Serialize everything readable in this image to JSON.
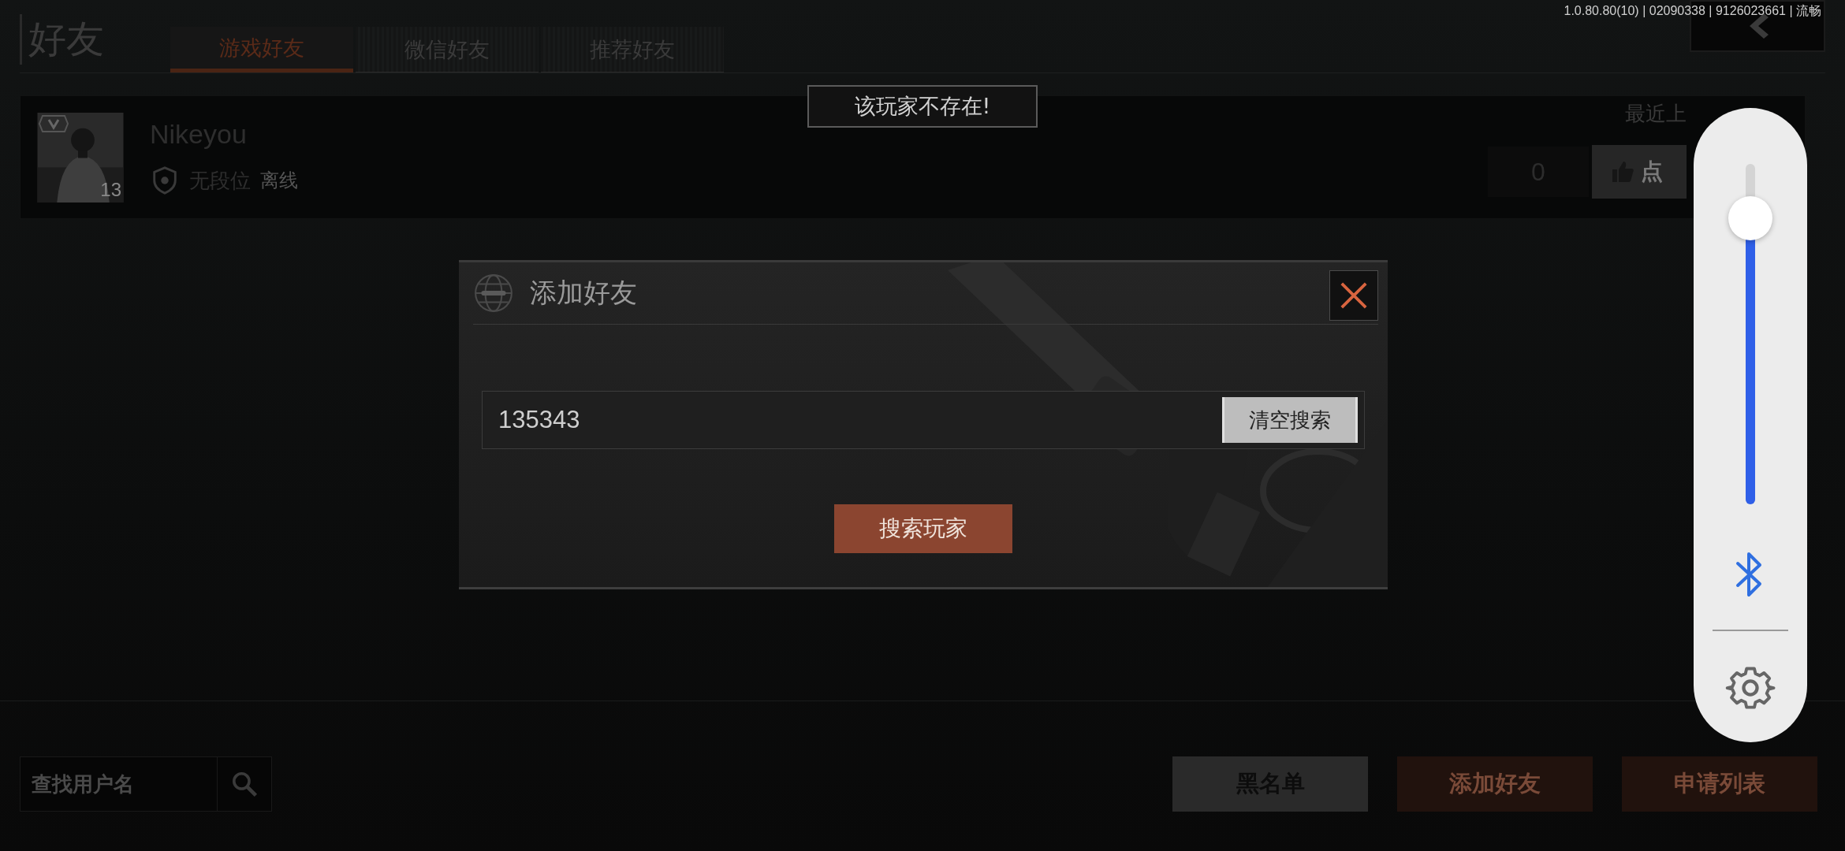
{
  "version_info": "1.0.80.80(10) | 02090338 | 9126023661 | 流畅",
  "header": {
    "title": "好友",
    "tabs": [
      {
        "label": "游戏好友",
        "selected": true
      },
      {
        "label": "微信好友",
        "selected": false
      },
      {
        "label": "推荐好友",
        "selected": false
      }
    ]
  },
  "friends": [
    {
      "name": "Nikeyou",
      "avatar_badge": "13",
      "rank": "无段位",
      "status": "离线",
      "last_online": "最近上",
      "likes": "0",
      "like_button": "点"
    }
  ],
  "search_box": {
    "placeholder": "查找用户名"
  },
  "bottom_buttons": [
    {
      "label": "黑名单",
      "kind": "neutral"
    },
    {
      "label": "添加好友",
      "kind": "accent"
    },
    {
      "label": "申请列表",
      "kind": "accent"
    }
  ],
  "toast": "该玩家不存在!",
  "dialog": {
    "title": "添加好友",
    "input": {
      "value": "135343"
    },
    "clear_button": "清空搜索",
    "search_button": "搜索玩家"
  },
  "volume_panel": {
    "level": 0.84
  }
}
